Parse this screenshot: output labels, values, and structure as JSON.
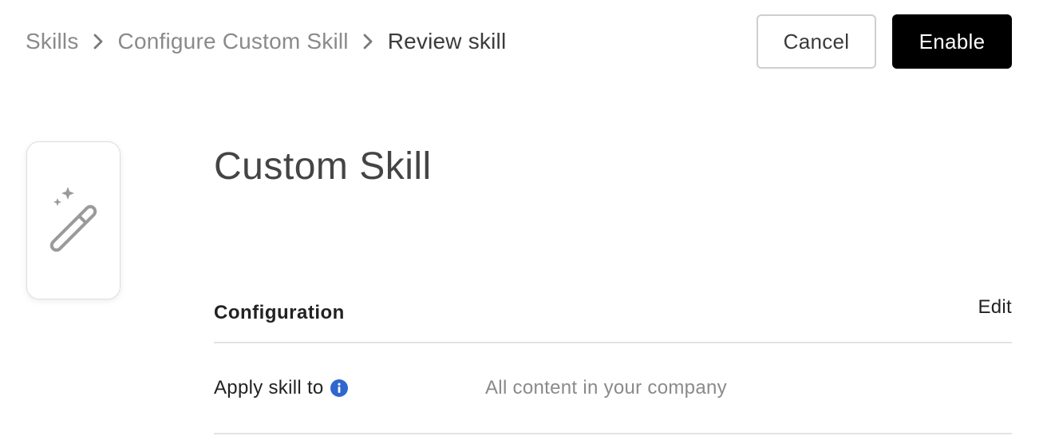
{
  "breadcrumb": {
    "items": [
      {
        "label": "Skills"
      },
      {
        "label": "Configure Custom Skill"
      },
      {
        "label": "Review skill"
      }
    ]
  },
  "actions": {
    "cancel_label": "Cancel",
    "enable_label": "Enable"
  },
  "skill": {
    "icon": "magic-wand-icon",
    "title": "Custom Skill"
  },
  "configuration": {
    "title": "Configuration",
    "edit_label": "Edit",
    "rows": [
      {
        "label": "Apply skill to",
        "value": "All content in your company",
        "info_icon": "info-icon"
      }
    ]
  },
  "colors": {
    "primary_button_bg": "#000000",
    "info_icon": "#2f66d0",
    "muted_text": "#8a8a8a",
    "divider": "#e3e3e3"
  }
}
